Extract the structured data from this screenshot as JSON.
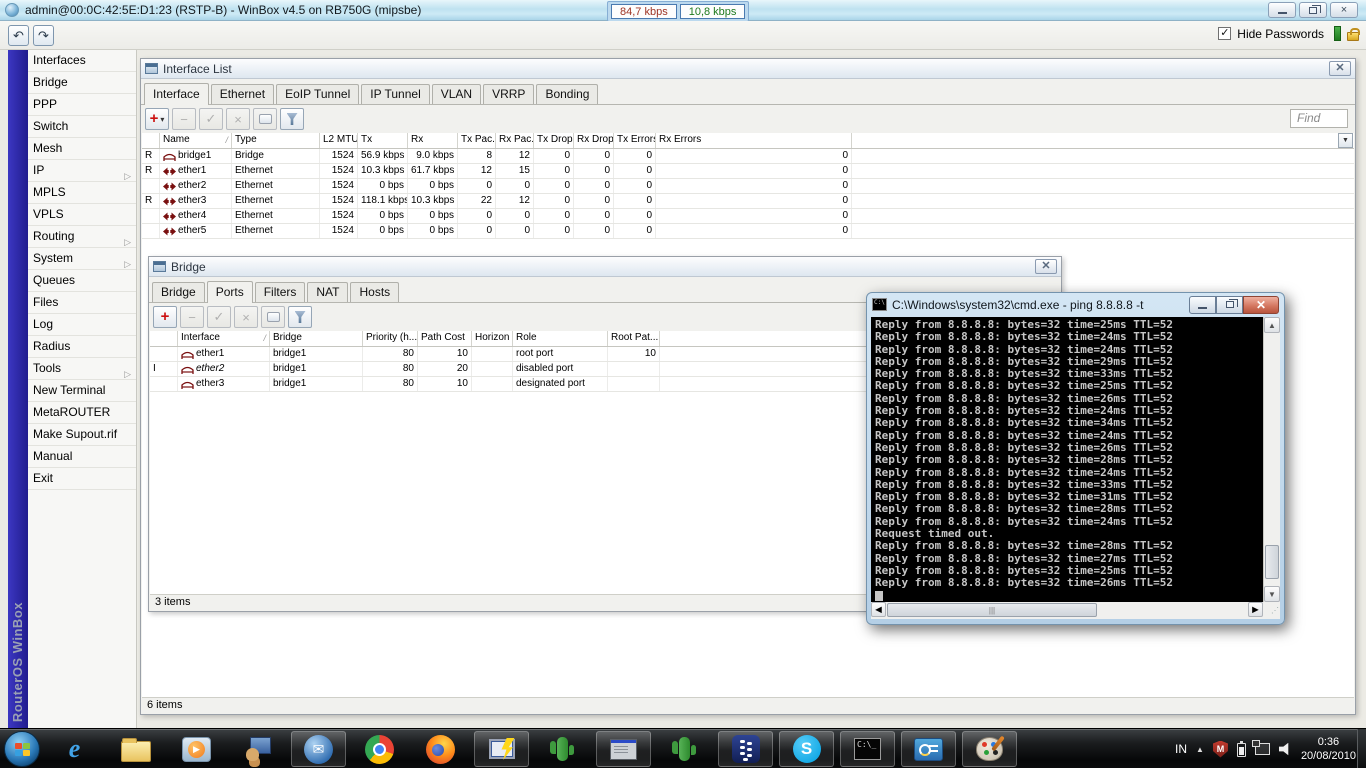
{
  "titlebar": {
    "title": "admin@00:0C:42:5E:D1:23 (RSTP-B) - WinBox v4.5 on RB750G (mipsbe)",
    "tx_rate": "84,7 kbps",
    "rx_rate": "10,8 kbps"
  },
  "menubar": {
    "hide_passwords_label": "Hide Passwords"
  },
  "sidebar": {
    "brand": "RouterOS WinBox",
    "items": [
      {
        "label": "Interfaces"
      },
      {
        "label": "Bridge"
      },
      {
        "label": "PPP"
      },
      {
        "label": "Switch"
      },
      {
        "label": "Mesh"
      },
      {
        "label": "IP",
        "has_submenu": true
      },
      {
        "label": "MPLS"
      },
      {
        "label": "VPLS"
      },
      {
        "label": "Routing",
        "has_submenu": true
      },
      {
        "label": "System",
        "has_submenu": true
      },
      {
        "label": "Queues"
      },
      {
        "label": "Files"
      },
      {
        "label": "Log"
      },
      {
        "label": "Radius"
      },
      {
        "label": "Tools",
        "has_submenu": true
      },
      {
        "label": "New Terminal"
      },
      {
        "label": "MetaROUTER"
      },
      {
        "label": "Make Supout.rif"
      },
      {
        "label": "Manual"
      },
      {
        "label": "Exit"
      }
    ]
  },
  "interface_list": {
    "title": "Interface List",
    "tabs": [
      "Interface",
      "Ethernet",
      "EoIP Tunnel",
      "IP Tunnel",
      "VLAN",
      "VRRP",
      "Bonding"
    ],
    "active_tab": "Interface",
    "find_label": "Find",
    "columns": [
      "Name",
      "Type",
      "L2 MTU",
      "Tx",
      "Rx",
      "Tx Pac...",
      "Rx Pac...",
      "Tx Drops",
      "Rx Drops",
      "Tx Errors",
      "Rx Errors"
    ],
    "rows": [
      {
        "flags": "R",
        "icon": "bridge",
        "name": "bridge1",
        "type": "Bridge",
        "l2mtu": "1524",
        "tx": "56.9 kbps",
        "rx": "9.0 kbps",
        "tx_packet": "8",
        "rx_packet": "12",
        "tx_drops": "0",
        "rx_drops": "0",
        "tx_errors": "0",
        "rx_errors": "0"
      },
      {
        "flags": "R",
        "icon": "ethernet",
        "name": "ether1",
        "type": "Ethernet",
        "l2mtu": "1524",
        "tx": "10.3 kbps",
        "rx": "61.7 kbps",
        "tx_packet": "12",
        "rx_packet": "15",
        "tx_drops": "0",
        "rx_drops": "0",
        "tx_errors": "0",
        "rx_errors": "0"
      },
      {
        "flags": "",
        "icon": "ethernet",
        "name": "ether2",
        "type": "Ethernet",
        "l2mtu": "1524",
        "tx": "0 bps",
        "rx": "0 bps",
        "tx_packet": "0",
        "rx_packet": "0",
        "tx_drops": "0",
        "rx_drops": "0",
        "tx_errors": "0",
        "rx_errors": "0"
      },
      {
        "flags": "R",
        "icon": "ethernet",
        "name": "ether3",
        "type": "Ethernet",
        "l2mtu": "1524",
        "tx": "118.1 kbps",
        "rx": "10.3 kbps",
        "tx_packet": "22",
        "rx_packet": "12",
        "tx_drops": "0",
        "rx_drops": "0",
        "tx_errors": "0",
        "rx_errors": "0"
      },
      {
        "flags": "",
        "icon": "ethernet",
        "name": "ether4",
        "type": "Ethernet",
        "l2mtu": "1524",
        "tx": "0 bps",
        "rx": "0 bps",
        "tx_packet": "0",
        "rx_packet": "0",
        "tx_drops": "0",
        "rx_drops": "0",
        "tx_errors": "0",
        "rx_errors": "0"
      },
      {
        "flags": "",
        "icon": "ethernet",
        "name": "ether5",
        "type": "Ethernet",
        "l2mtu": "1524",
        "tx": "0 bps",
        "rx": "0 bps",
        "tx_packet": "0",
        "rx_packet": "0",
        "tx_drops": "0",
        "rx_drops": "0",
        "tx_errors": "0",
        "rx_errors": "0"
      }
    ],
    "status": "6 items"
  },
  "bridge": {
    "title": "Bridge",
    "tabs": [
      "Bridge",
      "Ports",
      "Filters",
      "NAT",
      "Hosts"
    ],
    "active_tab": "Ports",
    "columns": [
      "Interface",
      "Bridge",
      "Priority (h...",
      "Path Cost",
      "Horizon",
      "Role",
      "Root Pat..."
    ],
    "rows": [
      {
        "flags": "",
        "interface": "ether1",
        "bridge": "bridge1",
        "priority": "80",
        "path_cost": "10",
        "horizon": "",
        "role": "root port",
        "root_path_cost": "10"
      },
      {
        "flags": "I",
        "interface": "ether2",
        "bridge": "bridge1",
        "priority": "80",
        "path_cost": "20",
        "horizon": "",
        "role": "disabled port",
        "root_path_cost": ""
      },
      {
        "flags": "",
        "interface": "ether3",
        "bridge": "bridge1",
        "priority": "80",
        "path_cost": "10",
        "horizon": "",
        "role": "designated port",
        "root_path_cost": ""
      }
    ],
    "status": "3 items"
  },
  "cmd": {
    "title": "C:\\Windows\\system32\\cmd.exe - ping  8.8.8.8 -t",
    "lines": [
      "Reply from 8.8.8.8: bytes=32 time=25ms TTL=52",
      "Reply from 8.8.8.8: bytes=32 time=24ms TTL=52",
      "Reply from 8.8.8.8: bytes=32 time=24ms TTL=52",
      "Reply from 8.8.8.8: bytes=32 time=29ms TTL=52",
      "Reply from 8.8.8.8: bytes=32 time=33ms TTL=52",
      "Reply from 8.8.8.8: bytes=32 time=25ms TTL=52",
      "Reply from 8.8.8.8: bytes=32 time=26ms TTL=52",
      "Reply from 8.8.8.8: bytes=32 time=24ms TTL=52",
      "Reply from 8.8.8.8: bytes=32 time=34ms TTL=52",
      "Reply from 8.8.8.8: bytes=32 time=24ms TTL=52",
      "Reply from 8.8.8.8: bytes=32 time=26ms TTL=52",
      "Reply from 8.8.8.8: bytes=32 time=28ms TTL=52",
      "Reply from 8.8.8.8: bytes=32 time=24ms TTL=52",
      "Reply from 8.8.8.8: bytes=32 time=33ms TTL=52",
      "Reply from 8.8.8.8: bytes=32 time=31ms TTL=52",
      "Reply from 8.8.8.8: bytes=32 time=28ms TTL=52",
      "Reply from 8.8.8.8: bytes=32 time=24ms TTL=52",
      "Request timed out.",
      "Reply from 8.8.8.8: bytes=32 time=28ms TTL=52",
      "Reply from 8.8.8.8: bytes=32 time=27ms TTL=52",
      "Reply from 8.8.8.8: bytes=32 time=25ms TTL=52",
      "Reply from 8.8.8.8: bytes=32 time=26ms TTL=52"
    ]
  },
  "taskbar": {
    "icons": [
      "start",
      "internet-explorer",
      "windows-explorer",
      "media-player",
      "remote-desktop",
      "thunderbird",
      "chrome",
      "firefox",
      "winbox",
      "cacti",
      "winbox-loader",
      "cacti",
      "blackberry",
      "skype",
      "command-prompt",
      "display-settings",
      "paint"
    ],
    "tray": {
      "language": "IN",
      "time": "0:36",
      "date": "20/08/2010"
    }
  }
}
